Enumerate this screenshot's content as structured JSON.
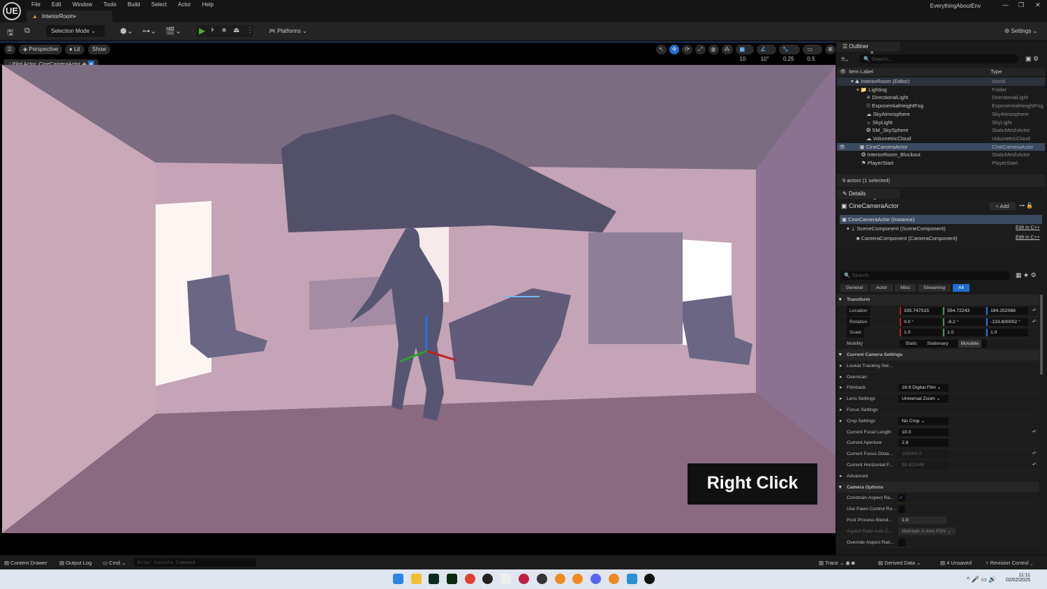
{
  "app": {
    "logo": "UE",
    "project": "EverythingAboutEnv",
    "tab": "InteriorRoom•",
    "menu": [
      "File",
      "Edit",
      "Window",
      "Tools",
      "Build",
      "Select",
      "Actor",
      "Help"
    ]
  },
  "toolbar": {
    "selection_mode": "Selection Mode",
    "platforms": "Platforms",
    "settings": "Settings"
  },
  "viewport": {
    "perspective": "Perspective",
    "lit": "Lit",
    "show": "Show",
    "pilot": "Pilot Actor: CineCameraActor",
    "grid": "10",
    "angle": "10°",
    "scale": "0.25",
    "camspeed": "0.5",
    "overlay": "Right Click"
  },
  "outliner": {
    "title": "Outliner",
    "search": "Search...",
    "col_label": "Item Label",
    "col_type": "Type",
    "status": "9 actors (1 selected)",
    "items": [
      {
        "label": "InteriorRoom (Editor)",
        "type": "World"
      },
      {
        "label": "Lighting",
        "type": "Folder"
      },
      {
        "label": "DirectionalLight",
        "type": "DirectionalLight"
      },
      {
        "label": "ExponentialHeightFog",
        "type": "ExponentialHeightFog"
      },
      {
        "label": "SkyAtmosphere",
        "type": "SkyAtmosphere"
      },
      {
        "label": "SkyLight",
        "type": "SkyLight"
      },
      {
        "label": "SM_SkySphere",
        "type": "StaticMeshActor"
      },
      {
        "label": "VolumetricCloud",
        "type": "VolumetricCloud"
      },
      {
        "label": "CineCameraActor",
        "type": "CineCameraActor"
      },
      {
        "label": "InteriorRoom_Blockout",
        "type": "StaticMeshActor"
      },
      {
        "label": "PlayerStart",
        "type": "PlayerStart"
      }
    ]
  },
  "details": {
    "title": "Details",
    "actor": "CineCameraActor",
    "add": "Add",
    "instance": "CineCameraActor (Instance)",
    "comp1": "SceneComponent (SceneComponent)",
    "comp2": "CameraComponent (CameraComponent)",
    "edit": "Edit in C++",
    "search": "Search",
    "filters": [
      "General",
      "Actor",
      "Misc",
      "Streaming",
      "All"
    ],
    "transform": "Transform",
    "location": "Location",
    "rotation": "Rotation",
    "scale": "Scale",
    "mobility": "Mobility",
    "loc": [
      "335.747515",
      "554.72243",
      "184.252068"
    ],
    "rot": [
      "0.0 °",
      "-8.2 °",
      "-133.600002 °"
    ],
    "scl": [
      "1.0",
      "1.0",
      "1.0"
    ],
    "mob": [
      "Static",
      "Stationary",
      "Movable"
    ],
    "ccs": "Current Camera Settings",
    "lookat": "Lookat Tracking Set...",
    "overscan": "Overscan",
    "filmback": "Filmback",
    "filmback_v": "16:9 Digital Film",
    "lens": "Lens Settings",
    "lens_v": "Universal Zoom",
    "focus": "Focus Settings",
    "crop": "Crop Settings",
    "crop_v": "No Crop",
    "focal": "Current Focal Length",
    "focal_v": "10.0",
    "aperture": "Current Aperture",
    "aperture_v": "2.8",
    "focusd": "Current Focus Dista...",
    "focusd_v": "100000.0",
    "hfov": "Current Horizontal F...",
    "hfov_v": "99.821945",
    "advanced": "Advanced",
    "camopt": "Camera Options",
    "constrain": "Constrain Aspect Ra...",
    "pawn": "Use Pawn Control Ro...",
    "ppb": "Post Process Blend...",
    "ppb_v": "1.0",
    "arac": "Aspect Ratio Axis C...",
    "arac_v": "Maintain X-Axis FOV",
    "override": "Override Aspect Rati..."
  },
  "status": {
    "content": "Content Drawer",
    "output": "Output Log",
    "cmd": "Cmd",
    "console": "Enter Console Command",
    "trace": "Trace",
    "derived": "Derived Data",
    "unsaved": "4 Unsaved",
    "revision": "Revision Control"
  },
  "taskbar": {
    "time": "11:11",
    "date": "02/02/2025"
  }
}
